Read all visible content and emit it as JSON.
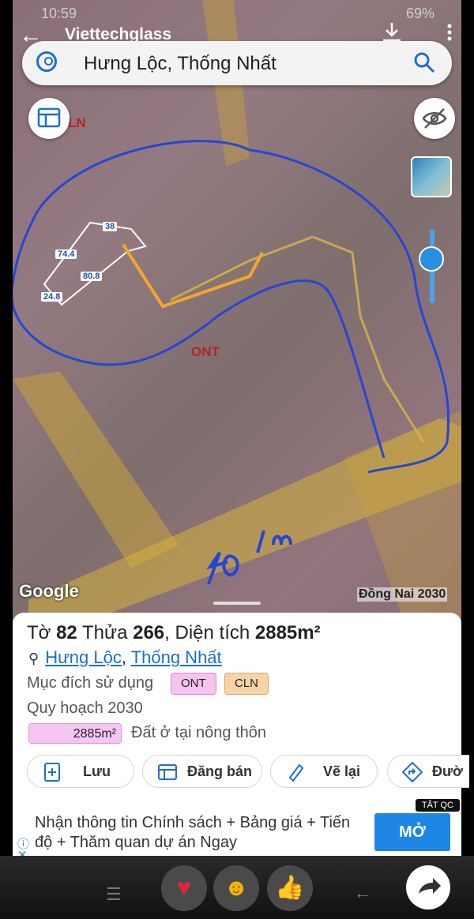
{
  "status": {
    "time": "10:59",
    "battery": "69%"
  },
  "app": {
    "title": "Viettechglass"
  },
  "search": {
    "value": "Hưng Lộc, Thống Nhất"
  },
  "map": {
    "labels": {
      "ln": "LN",
      "ont": "ONT"
    },
    "parcel_edges": [
      "38",
      "74.4",
      "80.8",
      "24.8"
    ],
    "handwriting": "40 m",
    "google": "Google",
    "plan_badge": "Đồng Nai 2030"
  },
  "sheet": {
    "to_label": "Tờ ",
    "to_value": "82",
    "thua_label": " Thửa ",
    "thua_value": "266",
    "area_label": ", Diện tích ",
    "area_value": "2885m²",
    "loc_commune": "Hưng Lộc",
    "loc_sep": ", ",
    "loc_district": "Thống Nhất",
    "purpose_label": "Mục đích sử dụng",
    "tags": [
      "ONT",
      "CLN"
    ],
    "plan_label": "Quy hoạch 2030",
    "plan_area": "2885m²",
    "plan_desc": "Đất ở tại nông thôn",
    "actions": [
      "Lưu",
      "Đăng bán",
      "Vẽ lại",
      "Đườ"
    ]
  },
  "ad": {
    "tag": "TẮT QC",
    "text": "Nhận thông tin Chính sách + Bảng giá + Tiến độ + Thăm quan dự án Ngay",
    "cta": "MỞ"
  },
  "icons": [
    "back-arrow-icon",
    "download-icon",
    "more-vert-icon",
    "user-circle-icon",
    "search-icon",
    "layers-icon",
    "eye-off-icon",
    "map-pin-icon",
    "add-file-icon",
    "sale-icon",
    "redraw-icon",
    "directions-icon",
    "share-icon"
  ],
  "colors": {
    "accent": "#1f6fd1",
    "ont": "#f7c2f0",
    "cln": "#f7d4a8",
    "cta": "#1e86e6"
  }
}
